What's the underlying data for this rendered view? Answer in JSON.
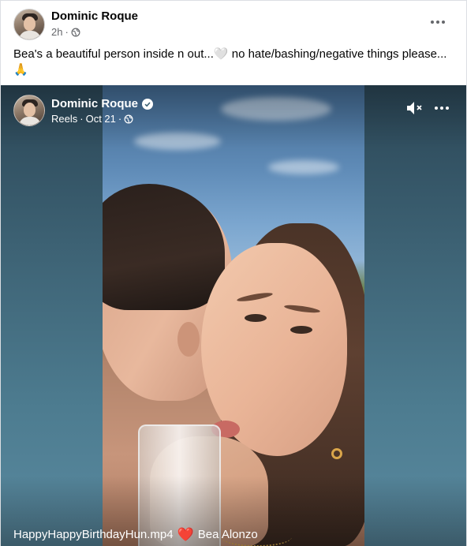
{
  "post": {
    "author": "Dominic Roque",
    "time": "2h",
    "separator": "·",
    "privacy_icon": "globe-icon",
    "more_icon": "more-dots-icon",
    "caption_part1": "Bea's a beautiful person inside n out...",
    "caption_heart": "🤍",
    "caption_part2": " no hate/bashing/negative things please...",
    "caption_emoji": "🙏"
  },
  "reel": {
    "author": "Dominic Roque",
    "verified_icon": "verified-badge-icon",
    "source": "Reels",
    "separator1": "·",
    "date": "Oct 21",
    "separator2": "·",
    "privacy_icon": "globe-icon",
    "mute_icon": "muted-speaker-icon",
    "more_icon": "more-dots-icon",
    "video_title": "HappyHappyBirthdayHun.mp4",
    "heart": "❤️",
    "tagged": "Bea Alonzo"
  }
}
